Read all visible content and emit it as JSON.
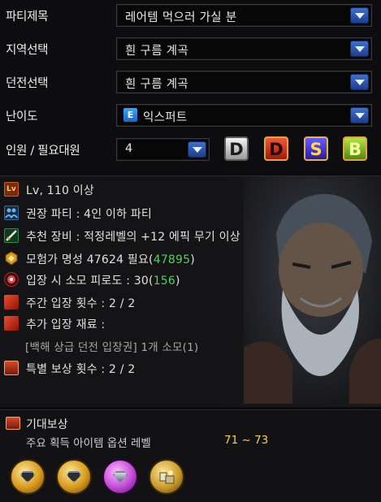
{
  "form": {
    "party_title": {
      "label": "파티제목",
      "value": "레어템 먹으러 가실 분"
    },
    "region": {
      "label": "지역선택",
      "value": "흰 구름 계곡"
    },
    "dungeon": {
      "label": "던전선택",
      "value": "흰 구름 계곡"
    },
    "difficulty": {
      "label": "난이도",
      "badge": "E",
      "value": "익스퍼트"
    },
    "members": {
      "label": "인원 / 필요대원",
      "value": "4"
    },
    "difficulty_buttons": [
      {
        "letter": "D",
        "color": "#d8d8d8"
      },
      {
        "letter": "D",
        "color": "#d9331c"
      },
      {
        "letter": "S",
        "color": "#4a3ad8"
      },
      {
        "letter": "B",
        "color": "#8ac22a"
      }
    ]
  },
  "info": {
    "lv_badge": "Lv",
    "level": "Lv, 110 이상",
    "recommended_party": "권장 파티 : 4인 이하 파티",
    "recommended_equip": "추천 장비 : 적정레벨의 +12 에픽 무기 이상",
    "fame_required": "모험가 명성 47624 필요(",
    "fame_current": "47895",
    "fame_close": ")",
    "fatigue": "입장 시 소모 피로도 : 30(",
    "fatigue_value": "156",
    "fatigue_close": ")",
    "weekly_entries": "주간 입장 횟수 : 2 / 2",
    "extra_material": "추가 입장 재료 :",
    "material_note": "[백해 상급 던전 입장권] 1개 소모(1)",
    "special_reward": "특별 보상 횟수 : 2 / 2"
  },
  "reward": {
    "title": "기대보상",
    "subtitle": "주요 획득 아이템 옵션 레벨",
    "level_range": "71 ~ 73"
  },
  "colors": {
    "accent_blue": "#2f5fc4",
    "highlight_green": "#52d15a",
    "gold": "#f4d24a"
  }
}
